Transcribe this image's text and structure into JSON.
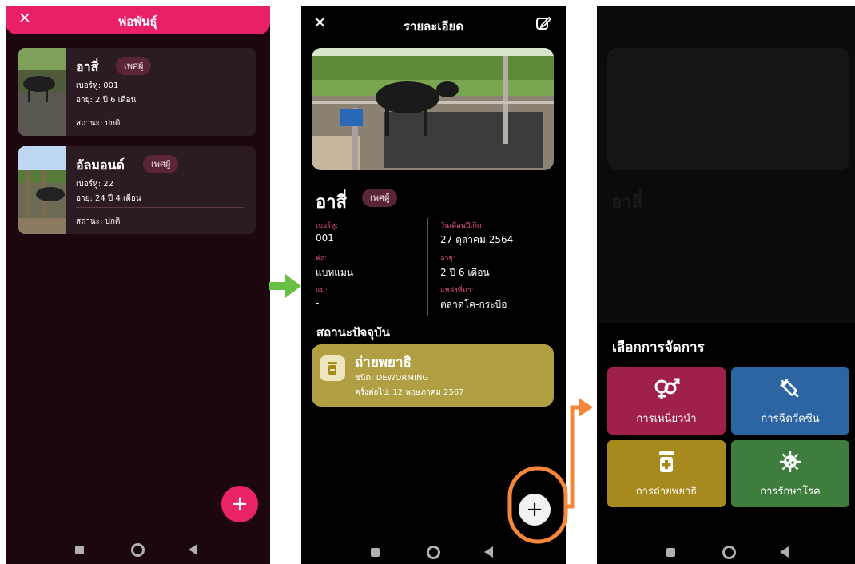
{
  "list_screen": {
    "close_icon": "close-icon",
    "title": "พ่อพันธุ์",
    "animals": [
      {
        "name": "อาสี่",
        "sex": "เพศผู้",
        "tag": "เบอร์หู: 001",
        "age": "อายุ: 2 ปี 6 เดือน",
        "status": "สถานะ: ปกติ"
      },
      {
        "name": "อัลมอนด์",
        "sex": "เพศผู้",
        "tag": "เบอร์หู: 22",
        "age": "อายุ: 24 ปี 4 เดือน",
        "status": "สถานะ: ปกติ"
      }
    ],
    "add_label": "+"
  },
  "detail_screen": {
    "title": "รายละเอียด",
    "name": "อาสี่",
    "sex": "เพศผู้",
    "fields": {
      "tag_label": "เบอร์หู:",
      "tag_value": "001",
      "birth_label": "วันเดือนปีเกิด:",
      "birth_value": "27 ตุลาคม 2564",
      "father_label": "พ่อ:",
      "father_value": "แบทแมน",
      "age_label": "อายุ:",
      "age_value": "2 ปี 6 เดือน",
      "mother_label": "แม่:",
      "mother_value": "-",
      "source_label": "แหล่งที่มา:",
      "source_value": "ตลาดโค-กระบือ"
    },
    "current_status_title": "สถานะปัจจุบัน",
    "status_card": {
      "title": "ถ่ายพยาธิ",
      "type": "ชนิด: DEWORMING",
      "next": "ครั้งต่อไป: 12 พฤษภาคม 2567"
    },
    "add_label": "+"
  },
  "manage_screen": {
    "title": "เลือกการจัดการ",
    "actions": [
      {
        "label": "การเหนี่ยวนำ",
        "icon": "gender-icon",
        "color": "#9f2149"
      },
      {
        "label": "การฉีดวัคซีน",
        "icon": "syringe-icon",
        "color": "#2d65a3"
      },
      {
        "label": "การถ่ายพยาธิ",
        "icon": "medicine-icon",
        "color": "#a68a1d"
      },
      {
        "label": "การรักษาโรค",
        "icon": "virus-icon",
        "color": "#3e7d3e"
      }
    ]
  },
  "colors": {
    "header_pink": "#e91f68",
    "arrow_green": "#6abf45",
    "arrow_orange": "#f4873a",
    "status_card": "#b09f43"
  }
}
